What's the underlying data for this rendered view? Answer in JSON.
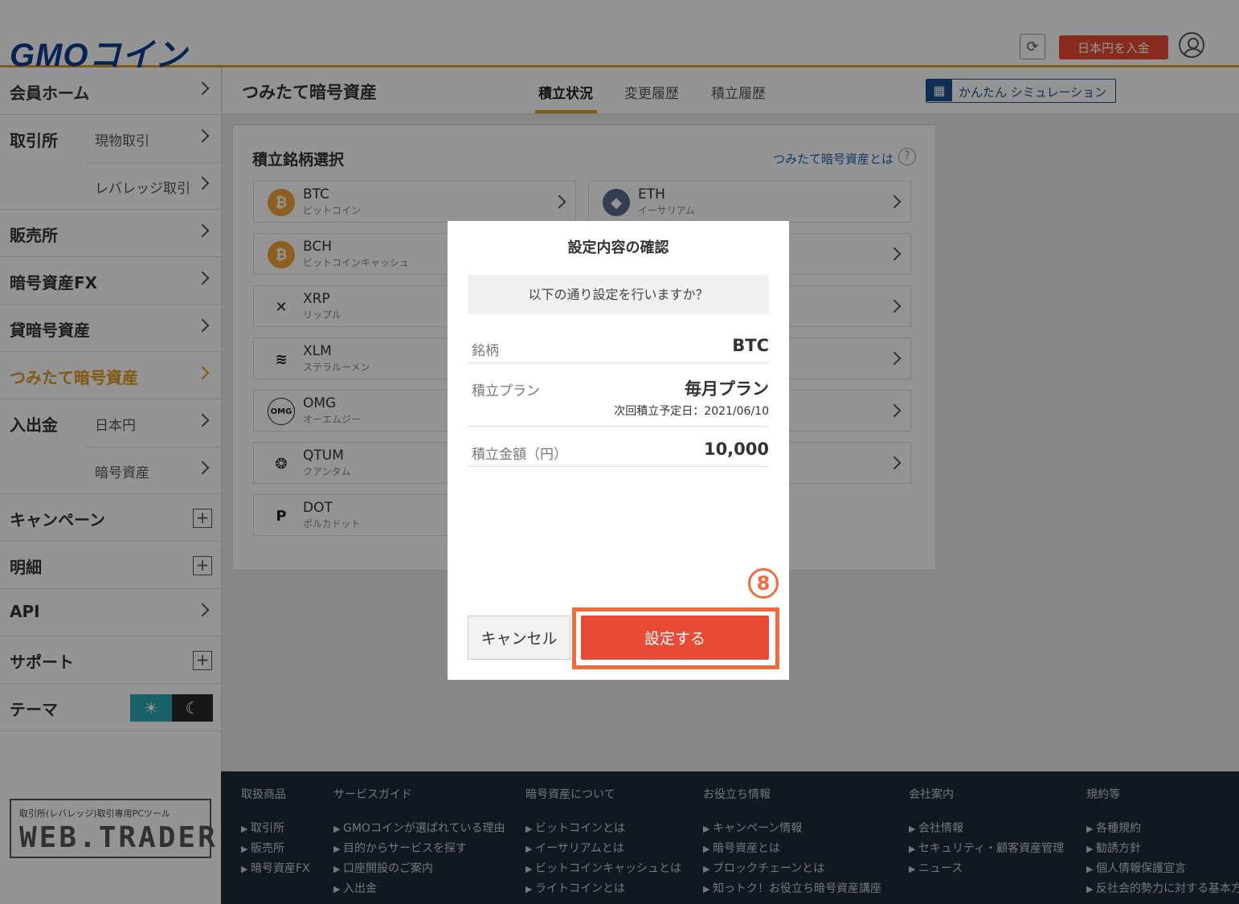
{
  "header": {
    "logo_main": "GMO",
    "logo_kana": "コイン",
    "deposit_label": "日本円を入金",
    "refresh_icon": "refresh-icon",
    "user_icon": "user-icon"
  },
  "sidebar": {
    "items": [
      {
        "label": "会員ホーム"
      },
      {
        "label": "取引所",
        "sub": [
          "現物取引",
          "レバレッジ取引"
        ]
      },
      {
        "label": "販売所"
      },
      {
        "label": "暗号資産FX"
      },
      {
        "label": "貸暗号資産"
      },
      {
        "label": "つみたて暗号資産",
        "active": true
      },
      {
        "label": "入出金",
        "sub": [
          "日本円",
          "暗号資産"
        ]
      },
      {
        "label": "キャンペーン"
      },
      {
        "label": "明細"
      },
      {
        "label": "API"
      },
      {
        "label": "サポート"
      },
      {
        "label": "テーマ"
      }
    ],
    "webtrader_caption": "取引所(レバレッジ)取引専用PCツール",
    "webtrader_logo": "WEB.TRADER"
  },
  "content_header": {
    "title": "つみたて暗号資産",
    "tabs": [
      {
        "label": "積立状況",
        "active": true
      },
      {
        "label": "変更履歴"
      },
      {
        "label": "積立履歴"
      }
    ],
    "simulation_label": "かんたん シミュレーション"
  },
  "panel": {
    "title": "積立銘柄選択",
    "about_link": "つみたて暗号資産とは",
    "coins": [
      {
        "symbol": "BTC",
        "name": "ビットコイン",
        "color": "#f2a33a",
        "glyph": "₿"
      },
      {
        "symbol": "ETH",
        "name": "イーサリアム",
        "color": "#5a6b8c",
        "glyph": "◆"
      },
      {
        "symbol": "BCH",
        "name": "ビットコインキャッシュ",
        "color": "#f2a33a",
        "glyph": "₿"
      },
      {
        "symbol": "",
        "name": "",
        "color": "#fff",
        "glyph": ""
      },
      {
        "symbol": "XRP",
        "name": "リップル",
        "color": "#fff",
        "glyph": "✕"
      },
      {
        "symbol": "",
        "name": "",
        "color": "#fff",
        "glyph": ""
      },
      {
        "symbol": "XLM",
        "name": "ステラルーメン",
        "color": "#fff",
        "glyph": "≋"
      },
      {
        "symbol": "",
        "name": "",
        "color": "#fff",
        "glyph": ""
      },
      {
        "symbol": "OMG",
        "name": "オーエムジー",
        "color": "#fff",
        "glyph": "OMG"
      },
      {
        "symbol": "",
        "name": "",
        "color": "#fff",
        "glyph": ""
      },
      {
        "symbol": "QTUM",
        "name": "クアンタム",
        "color": "#fff",
        "glyph": "❂"
      },
      {
        "symbol": "",
        "name": "",
        "color": "#fff",
        "glyph": ""
      },
      {
        "symbol": "DOT",
        "name": "ポルカドット",
        "color": "#fff",
        "glyph": "P"
      }
    ]
  },
  "footer": {
    "columns": [
      {
        "head": "取扱商品",
        "items": [
          "取引所",
          "販売所",
          "暗号資産FX"
        ]
      },
      {
        "head": "サービスガイド",
        "items": [
          "GMOコインが選ばれている理由",
          "目的からサービスを探す",
          "口座開設のご案内",
          "入出金"
        ]
      },
      {
        "head": "暗号資産について",
        "items": [
          "ビットコインとは",
          "イーサリアムとは",
          "ビットコインキャッシュとは",
          "ライトコインとは"
        ]
      },
      {
        "head": "お役立ち情報",
        "items": [
          "キャンペーン情報",
          "暗号資産とは",
          "ブロックチェーンとは",
          "知っトク！お役立ち暗号資産講座"
        ]
      },
      {
        "head": "会社案内",
        "items": [
          "会社情報",
          "セキュリティ・顧客資産管理",
          "ニュース"
        ]
      },
      {
        "head": "規約等",
        "items": [
          "各種規約",
          "勧誘方針",
          "個人情報保護宣言",
          "反社会的勢力に対する基本方針"
        ]
      }
    ]
  },
  "modal": {
    "title": "設定内容の確認",
    "prompt": "以下の通り設定を行いますか？",
    "rows": [
      {
        "label": "銘柄",
        "value": "BTC"
      },
      {
        "label": "積立プラン",
        "value": "毎月プラン",
        "sub": "次回積立予定日：2021/06/10"
      },
      {
        "label": "積立金額（円）",
        "value": "10,000"
      }
    ],
    "cancel_label": "キャンセル",
    "confirm_label": "設定する"
  },
  "annotation": {
    "step_label": "8",
    "color": "#f26b3a"
  }
}
